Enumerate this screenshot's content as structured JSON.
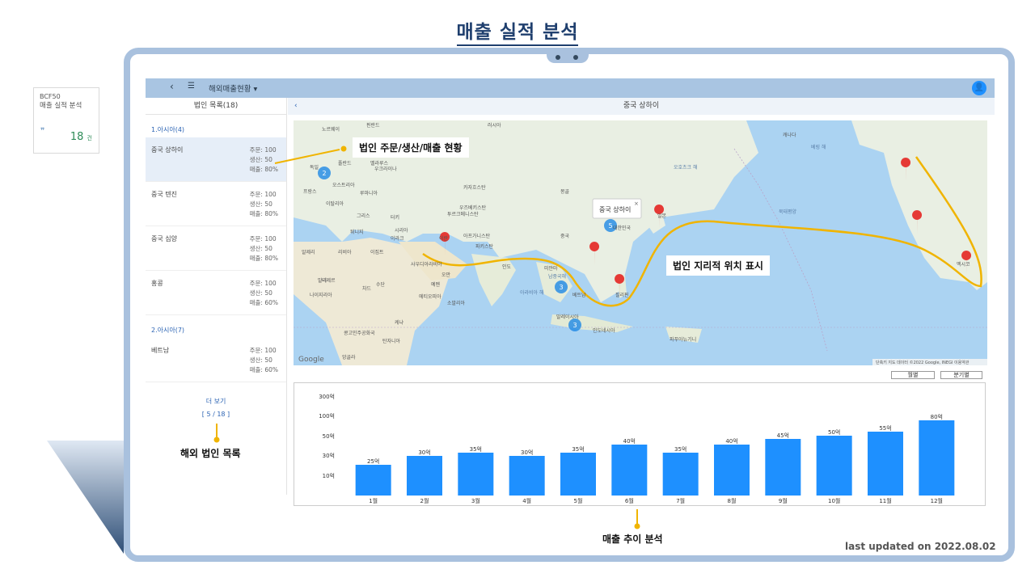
{
  "page": {
    "title": "매출 실적 분석",
    "updated": "last updated on 2022.08.02"
  },
  "side_card": {
    "code": "BCF50",
    "name": "매출 실적 분석",
    "count": "18",
    "unit": "건"
  },
  "appbar": {
    "menu_title": "해외매출현황 ▾"
  },
  "left_panel": {
    "header": "법인 목록(18)",
    "groups": [
      {
        "label": "1.아시아(4)",
        "items": [
          {
            "name": "중국 상하이",
            "order": "주문: 100",
            "prod": "생산: 50",
            "sales": "매출: 80%"
          },
          {
            "name": "중국 텐진",
            "order": "주문: 100",
            "prod": "생산: 50",
            "sales": "매출: 80%"
          },
          {
            "name": "중국 심양",
            "order": "주문: 100",
            "prod": "생산: 50",
            "sales": "매출: 80%"
          },
          {
            "name": "홍콩",
            "order": "주문: 100",
            "prod": "생산: 50",
            "sales": "매출: 60%"
          }
        ]
      },
      {
        "label": "2.아시아(7)",
        "items": [
          {
            "name": "베트남",
            "order": "주문: 100",
            "prod": "생산: 50",
            "sales": "매출: 60%"
          }
        ]
      }
    ],
    "more": "더 보기",
    "pager": "[ 5 / 18 ]"
  },
  "right_panel": {
    "header": "중국 상하이"
  },
  "map": {
    "popup": "중국 상하이",
    "logo": "Google",
    "credits": "단축키  지도 데이터 ©2022 Google, INEGI  이용약관",
    "labels": [
      "러시아",
      "노르웨이",
      "핀란드",
      "캐나다",
      "폴란드",
      "벨라루스",
      "우크라이나",
      "카자흐스탄",
      "몽골",
      "독일",
      "프랑스",
      "오스트리아",
      "루마니아",
      "이탈리아",
      "그리스",
      "터키",
      "투르크메니스탄",
      "우즈베키스탄",
      "아프가니스탄",
      "이란",
      "이라크",
      "시리아",
      "파키스탄",
      "중국",
      "대한민국",
      "일본",
      "인도",
      "미얀마",
      "베트남",
      "필리핀",
      "말레이시아",
      "인도네시아",
      "사우디아라비아",
      "예멘",
      "오만",
      "이집트",
      "리비아",
      "알제리",
      "튀니지",
      "말리",
      "니제르",
      "차드",
      "수단",
      "에티오피아",
      "소말리아",
      "케냐",
      "콩고민주공화국",
      "탄자니아",
      "앙골라",
      "나이지리아",
      "파푸아뉴기니",
      "북태평양",
      "오호츠크 해",
      "베링 해",
      "남중국해",
      "아라비아 해",
      "멕시코"
    ]
  },
  "map_buttons": {
    "monthly": "월별",
    "quarterly": "분기별"
  },
  "callouts": {
    "orders": "법인 주문/생산/매출 현황",
    "geo": "법인 지리적 위치 표시",
    "list": "해외 법인 목록",
    "trend": "매출 추이 분석"
  },
  "chart_data": {
    "type": "bar",
    "categories": [
      "1월",
      "2월",
      "3월",
      "4월",
      "5월",
      "6월",
      "7월",
      "8월",
      "9월",
      "10월",
      "11월",
      "12월"
    ],
    "values": [
      25,
      30,
      35,
      30,
      35,
      40,
      35,
      40,
      45,
      50,
      55,
      80
    ],
    "value_labels": [
      "25억",
      "30억",
      "35억",
      "30억",
      "35억",
      "40억",
      "35억",
      "40억",
      "45억",
      "50억",
      "55억",
      "80억"
    ],
    "y_ticks": [
      "10억",
      "30억",
      "50억",
      "100억",
      "300억"
    ],
    "bar_color": "#1e90ff"
  },
  "colors": {
    "accent": "#1f3f6e",
    "frame": "#a9c1de",
    "route": "#f0b400",
    "pin": "#e53935",
    "cluster": "#1e88e5"
  }
}
